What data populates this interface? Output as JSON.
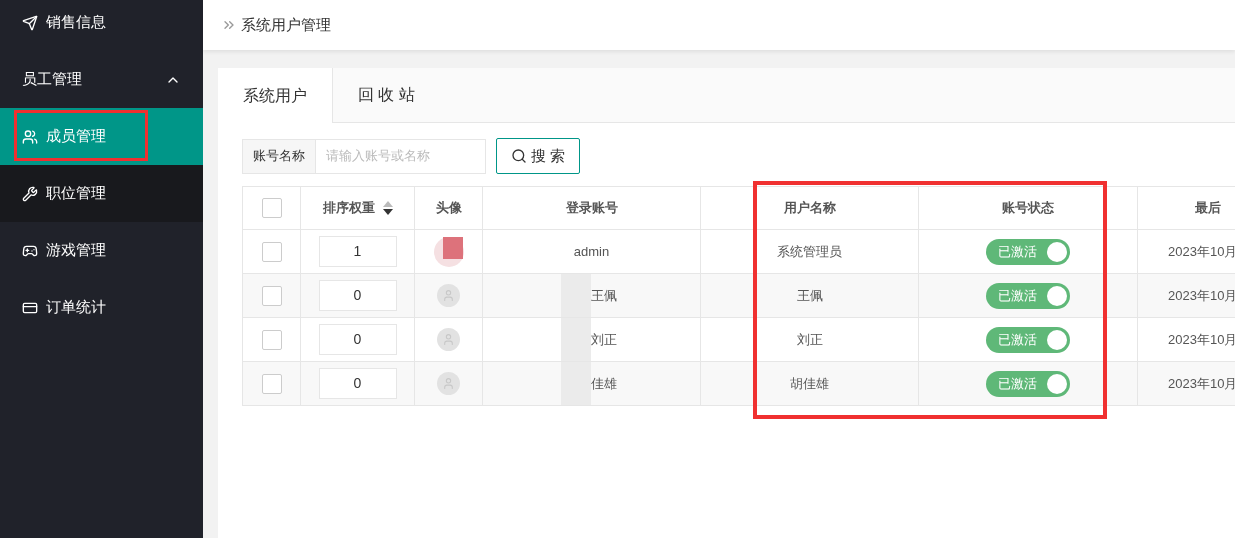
{
  "sidebar": {
    "items": [
      {
        "label": "销售信息",
        "selected": false
      },
      {
        "label": "员工管理",
        "expanded": true,
        "children": [
          {
            "label": "成员管理",
            "selected": true
          },
          {
            "label": "职位管理",
            "selected": false
          }
        ]
      },
      {
        "label": "游戏管理",
        "selected": false
      },
      {
        "label": "订单统计",
        "selected": false
      }
    ]
  },
  "breadcrumb": "系统用户管理",
  "tabs": [
    {
      "label": "系统用户",
      "selected": true
    },
    {
      "label": "回 收 站",
      "selected": false
    }
  ],
  "search": {
    "label": "账号名称",
    "placeholder": "请输入账号或名称",
    "button": "搜 索"
  },
  "table": {
    "all_checked": false,
    "columns": [
      "排序权重",
      "头像",
      "登录账号",
      "用户名称",
      "账号状态",
      "最后"
    ],
    "rows": [
      {
        "checked": false,
        "weight": "1",
        "kind": "picture",
        "login": "admin",
        "name": "系统管理员",
        "status": "已激活",
        "active": true,
        "last": "2023年10月"
      },
      {
        "checked": false,
        "weight": "0",
        "kind": "placeholder",
        "login": "王佩",
        "name": "王佩",
        "status": "已激活",
        "active": true,
        "last": "2023年10月"
      },
      {
        "checked": false,
        "weight": "0",
        "kind": "placeholder",
        "login": "刘正",
        "name": "刘正",
        "status": "已激活",
        "active": true,
        "last": "2023年10月"
      },
      {
        "checked": false,
        "weight": "0",
        "kind": "placeholder",
        "login": "佳雄",
        "name": "胡佳雄",
        "status": "已激活",
        "active": true,
        "last": "2023年10月"
      }
    ]
  }
}
